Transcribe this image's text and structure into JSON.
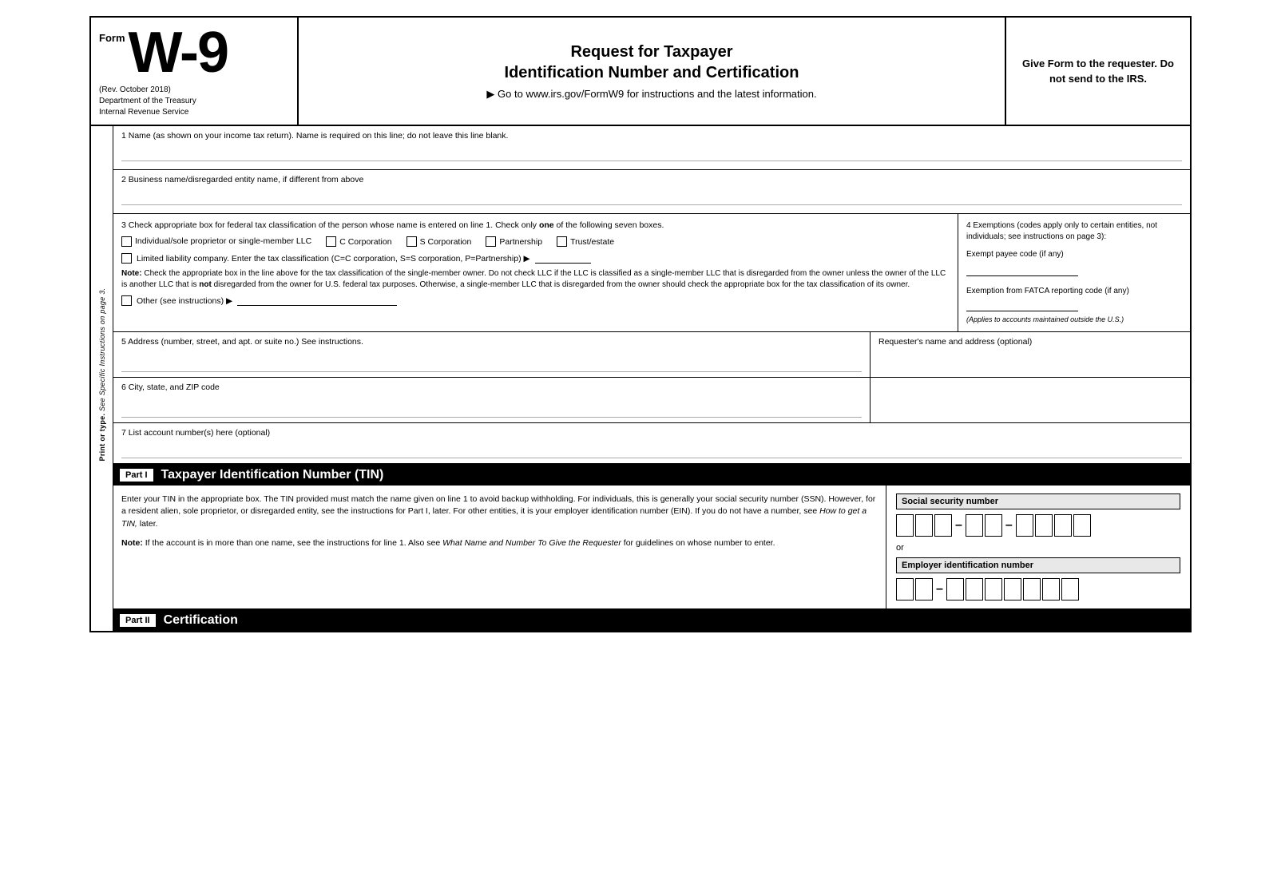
{
  "header": {
    "form_word": "Form",
    "w9": "W-9",
    "rev": "(Rev. October 2018)",
    "dept": "Department of the Treasury",
    "irs": "Internal Revenue Service",
    "title_line1": "Request for Taxpayer",
    "title_line2": "Identification Number and Certification",
    "subtitle": "▶ Go to www.irs.gov/FormW9 for instructions and the latest information.",
    "right_text": "Give Form to the requester. Do not send to the IRS."
  },
  "side_label": {
    "text": "Print or type.",
    "subtext": "See Specific Instructions on page 3."
  },
  "field1": {
    "label": "1 Name (as shown on your income tax return). Name is required on this line; do not leave this line blank."
  },
  "field2": {
    "label": "2 Business name/disregarded entity name, if different from above"
  },
  "field3": {
    "label_start": "3 Check appropriate box for federal tax classification of the person whose name is entered on line 1. Check only ",
    "label_bold": "one",
    "label_end": " of the following seven boxes.",
    "checkbox_individual": "Individual/sole proprietor or single-member LLC",
    "checkbox_c_corp": "C Corporation",
    "checkbox_s_corp": "S Corporation",
    "checkbox_partnership": "Partnership",
    "checkbox_trust": "Trust/estate",
    "llc_label": "Limited liability company. Enter the tax classification (C=C corporation, S=S corporation, P=Partnership) ▶",
    "note_bold": "Note:",
    "note_text": " Check the appropriate box in the line above for the tax classification of the single-member owner.  Do not check LLC if the LLC is classified as a single-member LLC that is disregarded from the owner unless the owner of the LLC is another LLC that is ",
    "note_not": "not",
    "note_text2": " disregarded from the owner for U.S. federal tax purposes. Otherwise, a single-member LLC that is disregarded from the owner should check the appropriate box for the tax classification of its owner.",
    "other_label": "Other (see instructions) ▶"
  },
  "field4": {
    "label": "4 Exemptions (codes apply only to certain entities, not individuals; see instructions on page 3):",
    "exempt_payee": "Exempt payee code (if any)",
    "fatca": "Exemption from FATCA reporting code (if any)",
    "applies": "(Applies to accounts maintained outside the U.S.)"
  },
  "field5": {
    "label": "5 Address (number, street, and apt. or suite no.) See instructions.",
    "right_label": "Requester's name and address (optional)"
  },
  "field6": {
    "label": "6 City, state, and ZIP code"
  },
  "field7": {
    "label": "7 List account number(s) here (optional)"
  },
  "part1": {
    "label": "Part I",
    "title": "Taxpayer Identification Number (TIN)",
    "body": "Enter your TIN in the appropriate box. The TIN provided must match the name given on line 1 to avoid backup withholding. For individuals, this is generally your social security number (SSN). However, for a resident alien, sole proprietor, or disregarded entity, see the instructions for Part I, later. For other entities, it is your employer identification number (EIN). If you do not have a number, see ",
    "body_italic": "How to get a TIN,",
    "body_end": " later.",
    "note_bold": "Note:",
    "note_text": " If the account is in more than one name, see the instructions for line 1. Also see ",
    "note_italic": "What Name and Number To Give the Requester",
    "note_end": " for guidelines on whose number to enter.",
    "ssn_label": "Social security number",
    "or_text": "or",
    "ein_label": "Employer identification number",
    "ssn_cells": [
      "",
      "",
      "",
      "",
      "",
      "",
      "",
      "",
      ""
    ],
    "ein_cells": [
      "",
      "",
      "",
      "",
      "",
      "",
      "",
      "",
      ""
    ]
  },
  "part2": {
    "label": "Part II",
    "title": "Certification"
  }
}
